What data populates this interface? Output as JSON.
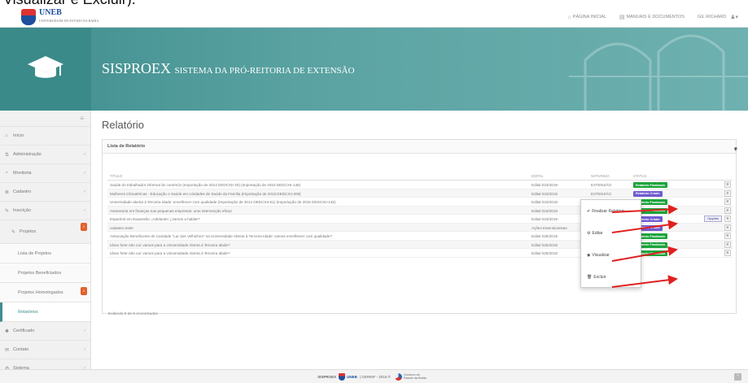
{
  "caption": "Visualizar e Excluir).",
  "topbar": {
    "logo_text": "UNEB",
    "logo_sub": "UNIVERSIDADE DO ESTADO DA BAHIA",
    "nav": [
      {
        "icon": "home-icon",
        "label": "PÁGINA INICIAL"
      },
      {
        "icon": "book-icon",
        "label": "MANUAIS E DOCUMENTOS"
      },
      {
        "icon": "user-icon",
        "label": "GIL RICHARD"
      }
    ]
  },
  "banner": {
    "title_main": "SISPROEX",
    "title_sub": "SISTEMA DA PRÓ-REITORIA DE EXTENSÃO"
  },
  "sidebar": {
    "toggle": "≡",
    "items": [
      {
        "icon": "home-icon",
        "label": "Início"
      },
      {
        "icon": "sliders-icon",
        "label": "Administração"
      },
      {
        "icon": "dashboard-icon",
        "label": "Monitoria"
      },
      {
        "icon": "list-icon",
        "label": "Cadastro"
      },
      {
        "icon": "edit-icon",
        "label": "Inscrição"
      },
      {
        "icon": "edit-icon",
        "label": "Projetos",
        "badge": "1"
      },
      {
        "label": "Lista de Projetos"
      },
      {
        "label": "Projetos Beneficiados"
      },
      {
        "label": "Projetos Homologados",
        "badge": "1"
      },
      {
        "label": "Relatórios"
      },
      {
        "icon": "certificate-icon",
        "label": "Certificado"
      },
      {
        "icon": "mail-icon",
        "label": "Contato"
      },
      {
        "icon": "cogs-icon",
        "label": "Sistema"
      }
    ]
  },
  "main": {
    "page_title": "Relatório",
    "panel_title": "Lista de Relatório",
    "columns": [
      "TÍTULO",
      "EDITAL",
      "NATUREZA",
      "STATUS"
    ],
    "rows": [
      {
        "title": "Saúde do trabalhador informal do comércio (Importação de 2014 DEDCXII-40) (Importação de 2015 DEDCXII-148)",
        "edital": "Edital 023/2019",
        "natureza": "EXTENSÃO",
        "status": "Relatório Finalizado"
      },
      {
        "title": "Mulheres Climatéricas - Educação e Saúde em Unidades de Saúde da Família (Importação de 2015 DEDCXII-208)",
        "edital": "Edital 023/2019",
        "natureza": "EXTENSÃO",
        "status": "Relatório Criado"
      },
      {
        "title": "Universidade aberta à Terceira Idade: envelhecer com qualidade (Importação de 2014 DEDCXII-51) (Importação de 2015 DEDCXII-145)",
        "edital": "Edital 023/2019",
        "natureza": "EXTENSÃO",
        "status": "Relatório Finalizado"
      },
      {
        "title": "Assessoria em finanças nas pequenas empresas: uma intervenção eficaz",
        "edital": "Edital 023/2019",
        "natureza": "EXTENSÃO",
        "status": "Relatório Finalizado"
      },
      {
        "title": "Espanhol em Expansão: ¡Adelante! ¿Vamos a hablar?",
        "edital": "Edital 023/2019",
        "natureza": "EXTENSÃO",
        "status": "Relatório Criado"
      },
      {
        "title": "cadastro teste",
        "edital": "Ações Extensionistas",
        "natureza": "EXTENSÃO",
        "status": "Relatório Criado"
      },
      {
        "title": "Associação Beneficente de Caridade \"Lar dos Velhinhos\" na Universidade Aberta à Terceira Idade: vamos envelhecer com qualidade?",
        "edital": "Edital 025/2019",
        "natureza": "EXTENSÃO",
        "status": "Relatório Finalizado"
      },
      {
        "title": "Idoso forte não cai: vamos para a Universidade Aberta à Terceira Idade?",
        "edital": "Edital 025/2019",
        "natureza": "EXTENSÃO",
        "status": "Relatório Finalizado"
      },
      {
        "title": "Idoso forte não cai: vamos para a Universidade Aberta à Terceira Idade?",
        "edital": "Edital 025/2019",
        "natureza": "EXTENSÃO",
        "status": "Relatório Finalizado"
      }
    ],
    "options_label": "Opções",
    "footer": "Exibindo 9 de 9 encontrados"
  },
  "dropdown": {
    "items": [
      {
        "icon": "check-icon",
        "label": "Finalizar Relatório"
      },
      {
        "icon": "gear-icon",
        "label": "Editar"
      },
      {
        "icon": "eye-icon",
        "label": "Visualizar"
      },
      {
        "icon": "trash-icon",
        "label": "Excluir"
      }
    ]
  },
  "footer": {
    "text_left": "SISPROEX",
    "text_mid": "| GERINF - 2015 ®",
    "gov": "Governo do Estado da Bahia"
  },
  "colors": {
    "teal": "#3f8d8d",
    "finalizado": "#1aa33a",
    "criado": "#6f5bd1",
    "arrow": "#e02020"
  }
}
